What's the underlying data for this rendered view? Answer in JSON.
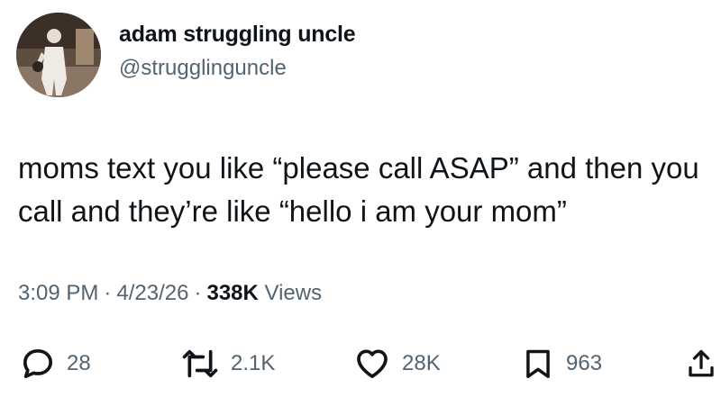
{
  "author": {
    "display_name": "adam struggling uncle",
    "handle": "@strugglinguncle"
  },
  "tweet": {
    "text": "moms text you like “please call ASAP” and then you call and they’re like “hello i am your mom”"
  },
  "meta": {
    "time": "3:09 PM",
    "separator": "·",
    "date": "4/23/26",
    "views_count": "338K",
    "views_label": "Views"
  },
  "actions": {
    "replies": "28",
    "reposts": "2.1K",
    "likes": "28K",
    "bookmarks": "963"
  },
  "icons": {
    "reply": "reply-icon",
    "repost": "repost-icon",
    "like": "heart-icon",
    "bookmark": "bookmark-icon",
    "share": "share-icon"
  },
  "colors": {
    "text": "#0f1419",
    "secondary": "#536471",
    "background": "#ffffff"
  }
}
